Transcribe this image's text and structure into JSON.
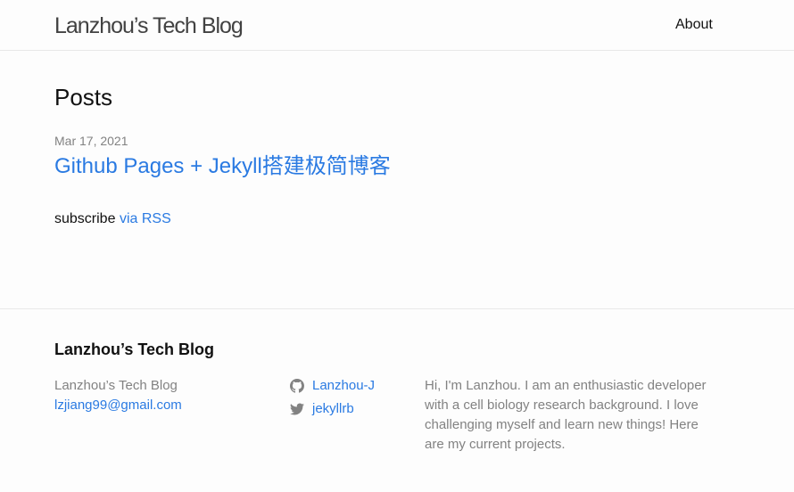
{
  "header": {
    "site_title": "Lanzhou’s Tech Blog",
    "nav": {
      "about": "About"
    }
  },
  "main": {
    "heading": "Posts",
    "posts": [
      {
        "date": "Mar 17, 2021",
        "title": "Github Pages + Jekyll搭建极简博客"
      }
    ],
    "subscribe_text": "subscribe",
    "subscribe_link": "via RSS"
  },
  "footer": {
    "heading": "Lanzhou’s Tech Blog",
    "name": "Lanzhou’s Tech Blog",
    "email": "lzjiang99@gmail.com",
    "social": {
      "github": {
        "icon": "github-icon",
        "username": "Lanzhou-J"
      },
      "twitter": {
        "icon": "twitter-icon",
        "username": "jekyllrb"
      }
    },
    "description": "Hi, I'm Lanzhou. I am an enthusiastic developer with a cell biology research background. I love challenging myself and learn new things! Here are my current projects."
  },
  "colors": {
    "link": "#2a7ae2",
    "text": "#111111",
    "muted": "#828282",
    "border": "#e8e8e8",
    "background": "#fdfdfd"
  }
}
